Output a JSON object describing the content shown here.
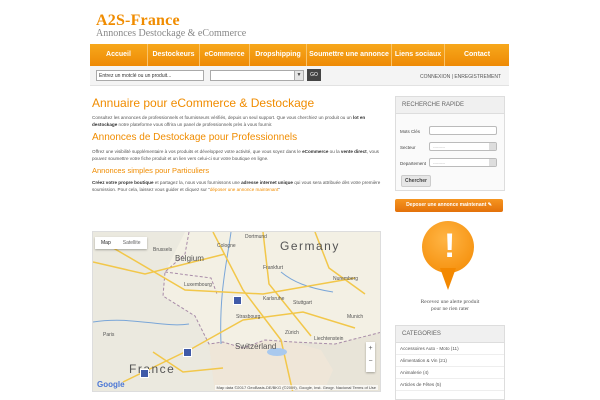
{
  "header": {
    "logo_title": "A2S-France",
    "logo_subtitle": "Annonces Destockage & eCommerce"
  },
  "nav": {
    "items": [
      "Accueil",
      "Destockeurs",
      "eCommerce",
      "Dropshipping",
      "Soumettre une annonce",
      "Liens sociaux",
      "Contact"
    ]
  },
  "search": {
    "placeholder": "Entrez un motclé ou un produit...",
    "go_label": "GO"
  },
  "auth": {
    "login": "CONNEXION",
    "separator": " | ",
    "register": "ENREGISTREMENT"
  },
  "main": {
    "title": "Annuaire pour eCommerce & Destockage",
    "intro_1": "Consultez les annonces de professionnels et fournisseurs vérifiés, depuis un seul support. Que vous cherchiez un produit ou un ",
    "intro_bold": "lot en destockage",
    "intro_2": " notre plateforme vous offrira un panel de professionnels près à vous fournir.",
    "pro_title": "Annonces de Destockage pour Professionnels",
    "pro_1": "Offrez une visibilité supplémentaire à vos produits et développez votre activité, que vous soyez dans le ",
    "pro_bold1": "eCommerce",
    "pro_2": " ou la ",
    "pro_bold2": "vente direct",
    "pro_3": ", vous pouvez soumettre votre fiche produit et un lien vers celui-ci sur votre boutique en ligne.",
    "part_title": "Annonces simples pour Particuliers",
    "part_bold1": "Créez votre propre boutique",
    "part_1": " et partagez la, nous vous fournissons une ",
    "part_bold2": "adresse internet unique",
    "part_2": " qui vous sera attribuée dès votre première soumission. Pour cela, laissez vous guider et cliquez sur \"",
    "part_link": "déposer une annonce maintenant",
    "part_3": "\""
  },
  "map": {
    "tab_map": "Map",
    "tab_satellite": "Satellite",
    "labels": {
      "germany": "Germany",
      "belgium": "Belgium",
      "luxembourg": "Luxembourg",
      "switzerland": "Switzerland",
      "france": "France",
      "liechtenstein": "Liechtenstein",
      "strasbourg": "Strasbourg",
      "karlsruhe": "Karlsruhe",
      "frankfurt": "Frankfurt",
      "dortmund": "Dortmund",
      "nuremberg": "Nuremberg",
      "munich": "Munich",
      "stuttgart": "Stuttgart",
      "cologne": "Cologne",
      "brussels": "Brussels",
      "paris": "Paris",
      "zurich": "Zürich"
    },
    "google": "Google",
    "credits": "Map data ©2017 GeoBasis-DE/BKG (©2009), Google, Inst. Geogr. Nacional   Terms of Use"
  },
  "sidebar": {
    "quick_title": "RECHERCHE RAPIDE",
    "keyword_label": "Mots Clés",
    "sector_label": "Secteur",
    "department_label": "Departement",
    "sector_value": "---------",
    "department_value": "---------",
    "search_button": "Chercher",
    "post_button": "Deposer une annonce maintenant ✎",
    "alert_line1": "Recevez une alerte produit",
    "alert_line2": "pour ne rien rater",
    "categories_title": "CATEGORIES",
    "categories": [
      "Accessoires Auto - Moto (11)",
      "Alimentation & Vin (21)",
      "Animalerie (4)",
      "Articles de Fêtes (5)"
    ]
  },
  "colors": {
    "brand": "#f08c00",
    "nav": "#f39a12"
  }
}
